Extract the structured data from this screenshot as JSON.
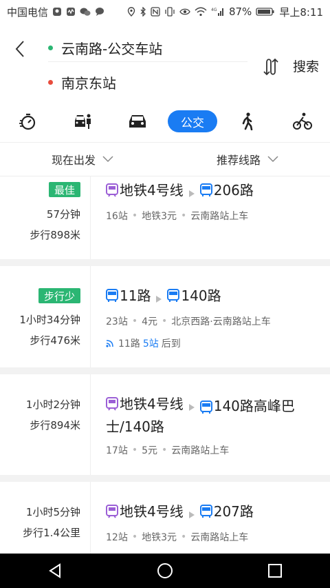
{
  "statusbar": {
    "carrier": "中国电信",
    "battery": "87%",
    "time": "早上8:11",
    "network": "4G"
  },
  "header": {
    "from": "云南路-公交车站",
    "to": "南京东站",
    "search_label": "搜索",
    "from_dot_color": "#2bb673",
    "to_dot_color": "#e84c3d"
  },
  "modes": {
    "active_label": "公交",
    "items": [
      "timer-icon",
      "taxi-icon",
      "car-icon",
      "bus",
      "walk-icon",
      "bike-icon"
    ]
  },
  "filters": {
    "depart": "现在出发",
    "sort": "推荐线路"
  },
  "routes": [
    {
      "badge": "最佳",
      "time": "57分钟",
      "walk": "步行898米",
      "lines": [
        {
          "type": "metro",
          "name": "地铁4号线"
        },
        {
          "type": "bus",
          "name": "206路"
        }
      ],
      "meta": [
        "16站",
        "地铁3元",
        "云南路站上车"
      ]
    },
    {
      "badge": "步行少",
      "time": "1小时34分钟",
      "walk": "步行476米",
      "lines": [
        {
          "type": "bus",
          "name": "11路"
        },
        {
          "type": "bus",
          "name": "140路"
        }
      ],
      "meta": [
        "23站",
        "4元",
        "北京西路·云南路站上车"
      ],
      "realtime": {
        "prefix": "11路",
        "count": "5站",
        "suffix": "后到"
      }
    },
    {
      "time": "1小时2分钟",
      "walk": "步行894米",
      "lines": [
        {
          "type": "metro",
          "name": "地铁4号线"
        },
        {
          "type": "bus",
          "name": "140路高峰巴士/140路"
        }
      ],
      "meta": [
        "17站",
        "5元",
        "云南路站上车"
      ]
    },
    {
      "time": "1小时5分钟",
      "walk": "步行1.4公里",
      "lines": [
        {
          "type": "metro",
          "name": "地铁4号线"
        },
        {
          "type": "bus",
          "name": "207路"
        }
      ],
      "meta": [
        "12站",
        "地铁3元",
        "云南路站上车"
      ]
    }
  ],
  "colors": {
    "accent": "#1a7cf3",
    "badge_green": "#2bb673",
    "metro_purple": "#9b5fd6"
  }
}
